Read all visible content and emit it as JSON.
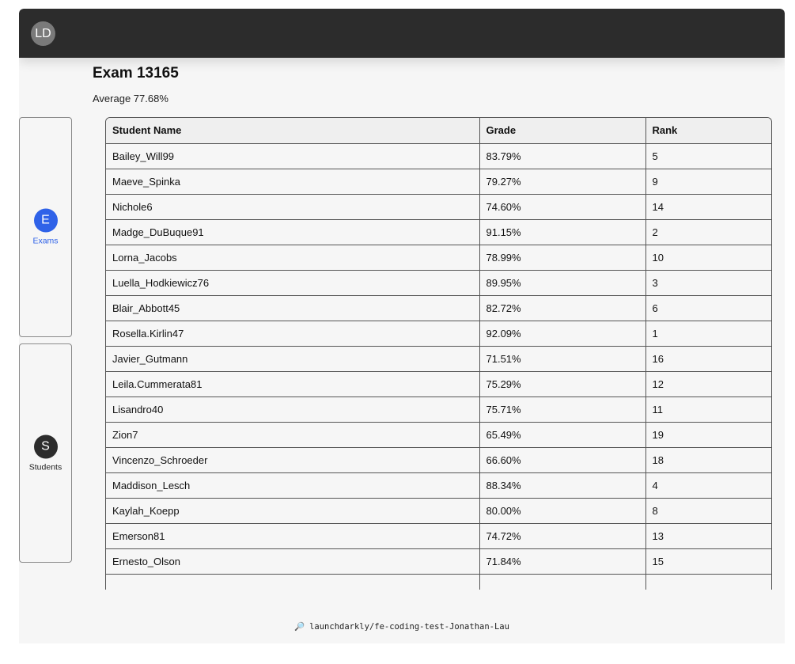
{
  "header": {
    "avatar_initials": "LD"
  },
  "exam": {
    "title": "Exam 13165",
    "average": "Average 77.68%"
  },
  "nav": {
    "items": [
      {
        "badge": "E",
        "label": "Exams",
        "active": true,
        "badge_color": "#2f62e8",
        "label_color": "#2f62e8"
      },
      {
        "badge": "S",
        "label": "Students",
        "active": false,
        "badge_color": "#2c2c2c",
        "label_color": "#222222"
      }
    ]
  },
  "table": {
    "headers": [
      "Student Name",
      "Grade",
      "Rank"
    ],
    "rows": [
      [
        "Bailey_Will99",
        "83.79%",
        "5"
      ],
      [
        "Maeve_Spinka",
        "79.27%",
        "9"
      ],
      [
        "Nichole6",
        "74.60%",
        "14"
      ],
      [
        "Madge_DuBuque91",
        "91.15%",
        "2"
      ],
      [
        "Lorna_Jacobs",
        "78.99%",
        "10"
      ],
      [
        "Luella_Hodkiewicz76",
        "89.95%",
        "3"
      ],
      [
        "Blair_Abbott45",
        "82.72%",
        "6"
      ],
      [
        "Rosella.Kirlin47",
        "92.09%",
        "1"
      ],
      [
        "Javier_Gutmann",
        "71.51%",
        "16"
      ],
      [
        "Leila.Cummerata81",
        "75.29%",
        "12"
      ],
      [
        "Lisandro40",
        "75.71%",
        "11"
      ],
      [
        "Zion7",
        "65.49%",
        "19"
      ],
      [
        "Vincenzo_Schroeder",
        "66.60%",
        "18"
      ],
      [
        "Maddison_Lesch",
        "88.34%",
        "4"
      ],
      [
        "Kaylah_Koepp",
        "80.00%",
        "8"
      ],
      [
        "Emerson81",
        "74.72%",
        "13"
      ],
      [
        "Ernesto_Olson",
        "71.84%",
        "15"
      ],
      [
        "",
        "",
        ""
      ]
    ]
  },
  "footer": {
    "icon": "magnifier-icon",
    "text": "launchdarkly/fe-coding-test-Jonathan-Lau"
  }
}
